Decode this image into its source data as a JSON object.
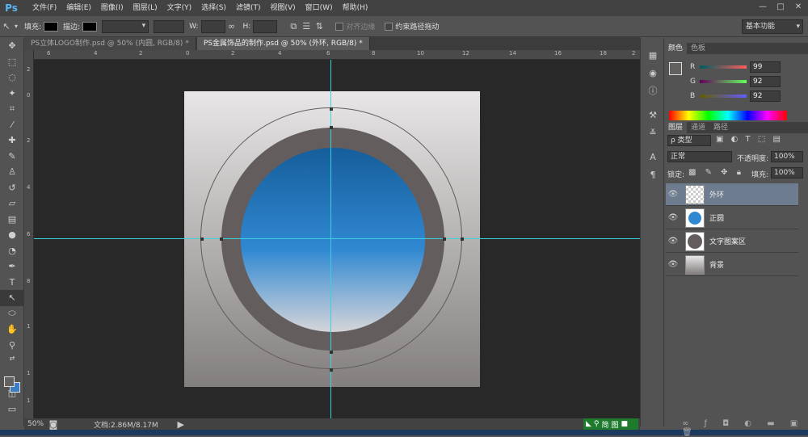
{
  "app": {
    "logo": "Ps"
  },
  "menu": [
    "文件(F)",
    "编辑(E)",
    "图像(I)",
    "图层(L)",
    "文字(Y)",
    "选择(S)",
    "滤镜(T)",
    "视图(V)",
    "窗口(W)",
    "帮助(H)"
  ],
  "window_controls": [
    "—",
    "□",
    "✕"
  ],
  "options": {
    "fill_label": "填充:",
    "stroke_label": "描边:",
    "w_label": "W:",
    "h_label": "H:",
    "align_edges": "对齐边缘",
    "constrain_path": "约束路径拖动",
    "workspace": "基本功能"
  },
  "tabs": [
    {
      "label": "PS立体LOGO制作.psd @ 50% (内圆, RGB/8) *",
      "active": false
    },
    {
      "label": "PS金属饰品的制作.psd @ 50% (外环, RGB/8) *",
      "active": true
    }
  ],
  "ruler_h_labels": [
    "6",
    "4",
    "2",
    "0",
    "2",
    "4",
    "6",
    "8",
    "10",
    "12",
    "14",
    "16",
    "18",
    "2"
  ],
  "ruler_v_labels": [
    "2",
    "0",
    "2",
    "4",
    "6",
    "8",
    "1",
    "1",
    "1"
  ],
  "status": {
    "zoom": "50%",
    "doc_size": "文档:2.86M/8.17M"
  },
  "taskbar": {
    "labels": [
      "简",
      "图"
    ]
  },
  "color_panel": {
    "tabs": [
      "颜色",
      "色板"
    ],
    "r_label": "R",
    "g_label": "G",
    "b_label": "B",
    "r": "99",
    "g": "92",
    "b": "92"
  },
  "layers_panel": {
    "tabs": [
      "图层",
      "通道",
      "路径"
    ],
    "filter": "ρ 类型",
    "blend_mode": "正常",
    "opacity_label": "不透明度:",
    "opacity": "100%",
    "lock_label": "锁定:",
    "fill_label": "填充:",
    "fill": "100%",
    "layers": [
      {
        "name": "外环",
        "selected": true
      },
      {
        "name": "正圆",
        "selected": false
      },
      {
        "name": "文字图案区",
        "selected": false
      },
      {
        "name": "背景",
        "selected": false
      }
    ]
  },
  "colors": {
    "accent": "#3ad0e0",
    "ring": "#635d5e",
    "blue": "#3088d2",
    "fg": "#636060",
    "bg": "#3c7dc4"
  }
}
